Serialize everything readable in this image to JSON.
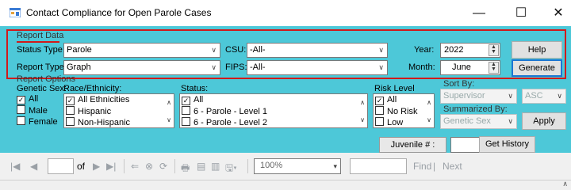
{
  "window": {
    "title": "Contact Compliance for Open Parole Cases",
    "minimize": "—",
    "maximize": "☐",
    "close": "✕"
  },
  "report_data": {
    "section_label": "Report Data",
    "status_type_label": "Status Type:",
    "status_type_value": "Parole",
    "report_type_label": "Report Type:",
    "report_type_value": "Graph",
    "csu_label": "CSU:",
    "csu_value": "-All-",
    "fips_label": "FIPS:",
    "fips_value": "-All-",
    "year_label": "Year:",
    "year_value": "2022",
    "month_label": "Month:",
    "month_value": "June",
    "help_button": "Help",
    "generate_button": "Generate"
  },
  "report_options": {
    "section_label": "Report Options",
    "genetic_sex_label": "Genetic Sex:",
    "genetic_sex_items": [
      {
        "label": "All",
        "checked": true
      },
      {
        "label": "Male",
        "checked": false
      },
      {
        "label": "Female",
        "checked": false
      }
    ],
    "race_label": "Race/Ethnicity:",
    "race_items": [
      {
        "label": "All Ethnicities",
        "checked": true
      },
      {
        "label": "Hispanic",
        "checked": false
      },
      {
        "label": "Non-Hispanic",
        "checked": false
      }
    ],
    "status_label": "Status:",
    "status_items": [
      {
        "label": "All",
        "checked": true
      },
      {
        "label": "6 - Parole - Level 1",
        "checked": false
      },
      {
        "label": "6 - Parole - Level 2",
        "checked": false
      }
    ],
    "risk_label": "Risk Level",
    "risk_items": [
      {
        "label": "All",
        "checked": true
      },
      {
        "label": "No Risk",
        "checked": false
      },
      {
        "label": "Low",
        "checked": false
      }
    ],
    "sort_by_label": "Sort By:",
    "sort_by_value": "Supervisor",
    "sort_dir_value": "ASC",
    "summarized_by_label": "Summarized By:",
    "summarized_by_value": "Genetic Sex",
    "apply_button": "Apply"
  },
  "history": {
    "juvenile_label": "Juvenile # :",
    "juvenile_value": "",
    "get_history_button": "Get History"
  },
  "report_toolbar": {
    "first_page": "|◀",
    "prev_page": "◀",
    "page_value": "",
    "of_label": "of",
    "next_page": "▶",
    "last_page": "▶|",
    "back": "⇐",
    "stop": "⊗",
    "refresh": "⟳",
    "print": "🖶",
    "print_layout": "▤",
    "page_setup": "▥",
    "export": "🖫▾",
    "zoom_value": "100%",
    "find_value": "",
    "find_label": "Find",
    "find_sep": "|",
    "next_label": "Next"
  },
  "colors": {
    "panel": "#4dc8d8",
    "highlight_border": "#d11a1a",
    "focus_border": "#1c76d2"
  }
}
